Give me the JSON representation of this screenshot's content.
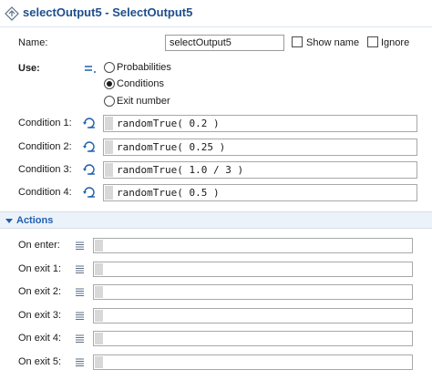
{
  "header": {
    "title": "selectOutput5 - SelectOutput5",
    "icon": "select-output-diamond-icon"
  },
  "properties": {
    "name_label": "Name:",
    "name_value": "selectOutput5",
    "show_name_label": "Show name",
    "show_name_checked": false,
    "ignore_label": "Ignore",
    "ignore_checked": false,
    "use_label": "Use:",
    "use_options": [
      "Probabilities",
      "Conditions",
      "Exit number"
    ],
    "use_selected": "Conditions",
    "conditions": [
      {
        "label": "Condition 1:",
        "code": "randomTrue( 0.2 )"
      },
      {
        "label": "Condition 2:",
        "code": "randomTrue( 0.25 )"
      },
      {
        "label": "Condition 3:",
        "code": "randomTrue( 1.0 / 3 )"
      },
      {
        "label": "Condition 4:",
        "code": "randomTrue( 0.5 )"
      }
    ]
  },
  "actions_section": {
    "title": "Actions",
    "expanded": true,
    "items": [
      {
        "label": "On enter:",
        "code": ""
      },
      {
        "label": "On exit 1:",
        "code": ""
      },
      {
        "label": "On exit 2:",
        "code": ""
      },
      {
        "label": "On exit 3:",
        "code": ""
      },
      {
        "label": "On exit 4:",
        "code": ""
      },
      {
        "label": "On exit 5:",
        "code": ""
      }
    ]
  },
  "colors": {
    "title": "#1f4e8c",
    "section_bar": "#ecf2fa",
    "accent": "#1f5fae"
  }
}
